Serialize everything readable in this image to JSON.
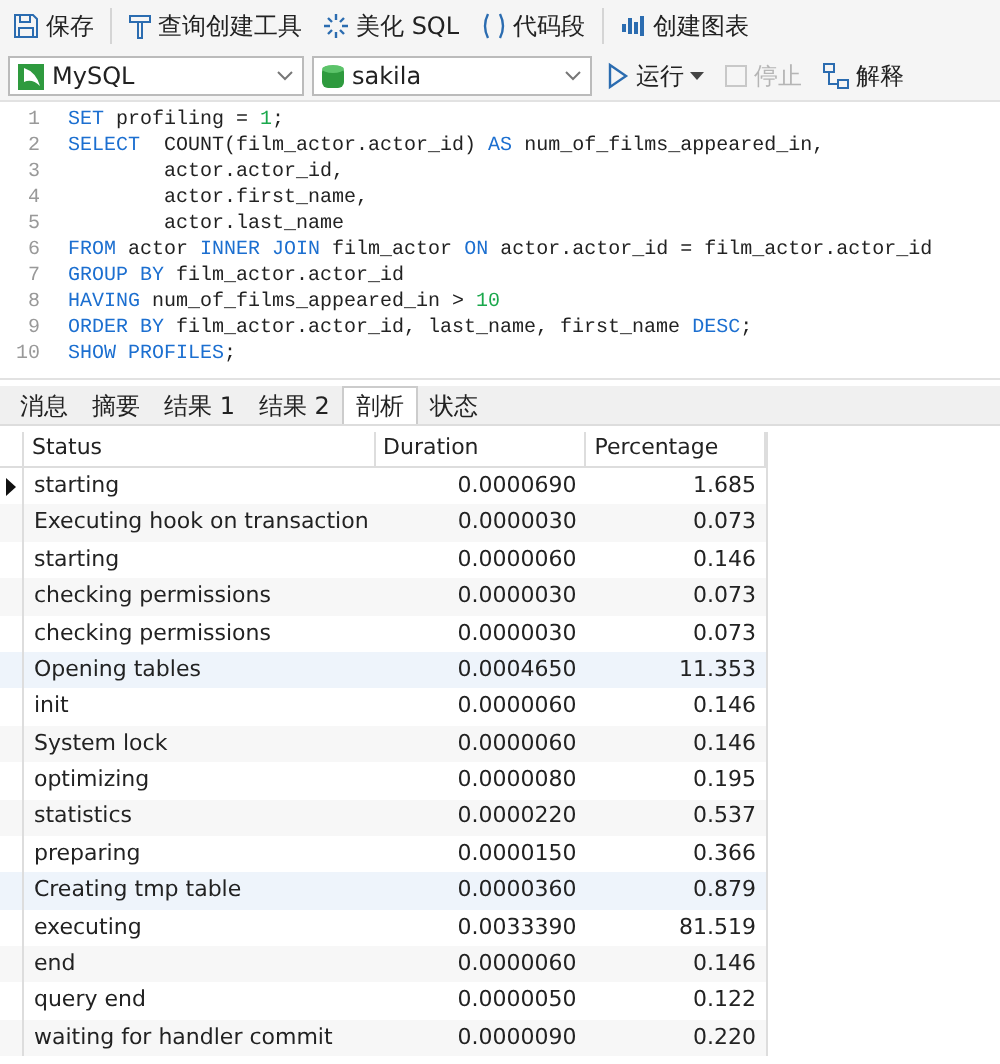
{
  "toolbar": [
    {
      "kind": "save",
      "label": "保存"
    },
    {
      "kind": "builder",
      "label": "查询创建工具"
    },
    {
      "kind": "beautify",
      "label": "美化 SQL"
    },
    {
      "kind": "snippet",
      "label": "代码段"
    },
    {
      "kind": "chart",
      "label": "创建图表"
    }
  ],
  "connection": {
    "value": "MySQL"
  },
  "database": {
    "value": "sakila"
  },
  "actions": [
    {
      "kind": "run",
      "label": "运行",
      "disabled": false
    },
    {
      "kind": "stop",
      "label": "停止",
      "disabled": true
    },
    {
      "kind": "explain",
      "label": "解释",
      "disabled": false
    }
  ],
  "editor": {
    "lines": [
      {
        "number": "1",
        "tokens": [
          {
            "kind": "keyword",
            "text": "SET"
          },
          {
            "kind": "plain",
            "text": " profiling = "
          },
          {
            "kind": "number",
            "text": "1"
          },
          {
            "kind": "plain",
            "text": ";"
          }
        ]
      },
      {
        "number": "2",
        "tokens": [
          {
            "kind": "keyword",
            "text": "SELECT"
          },
          {
            "kind": "plain",
            "text": "  COUNT(film_actor.actor_id) "
          },
          {
            "kind": "keyword",
            "text": "AS"
          },
          {
            "kind": "plain",
            "text": " num_of_films_appeared_in,"
          }
        ]
      },
      {
        "number": "3",
        "tokens": [
          {
            "kind": "plain",
            "text": "        actor.actor_id,"
          }
        ]
      },
      {
        "number": "4",
        "tokens": [
          {
            "kind": "plain",
            "text": "        actor.first_name,"
          }
        ]
      },
      {
        "number": "5",
        "tokens": [
          {
            "kind": "plain",
            "text": "        actor.last_name"
          }
        ]
      },
      {
        "number": "6",
        "tokens": [
          {
            "kind": "keyword",
            "text": "FROM"
          },
          {
            "kind": "plain",
            "text": " actor "
          },
          {
            "kind": "keyword",
            "text": "INNER JOIN"
          },
          {
            "kind": "plain",
            "text": " film_actor "
          },
          {
            "kind": "keyword",
            "text": "ON"
          },
          {
            "kind": "plain",
            "text": " actor.actor_id = film_actor.actor_id"
          }
        ]
      },
      {
        "number": "7",
        "tokens": [
          {
            "kind": "keyword",
            "text": "GROUP BY"
          },
          {
            "kind": "plain",
            "text": " film_actor.actor_id"
          }
        ]
      },
      {
        "number": "8",
        "tokens": [
          {
            "kind": "keyword",
            "text": "HAVING"
          },
          {
            "kind": "plain",
            "text": " num_of_films_appeared_in > "
          },
          {
            "kind": "number",
            "text": "10"
          }
        ]
      },
      {
        "number": "9",
        "tokens": [
          {
            "kind": "keyword",
            "text": "ORDER BY"
          },
          {
            "kind": "plain",
            "text": " film_actor.actor_id, last_name, first_name "
          },
          {
            "kind": "keyword",
            "text": "DESC"
          },
          {
            "kind": "plain",
            "text": ";"
          }
        ]
      },
      {
        "number": "10",
        "tokens": [
          {
            "kind": "keyword",
            "text": "SHOW PROFILES"
          },
          {
            "kind": "plain",
            "text": ";"
          }
        ]
      }
    ]
  },
  "result_tabs": [
    {
      "label": "消息",
      "selected": false
    },
    {
      "label": "摘要",
      "selected": false
    },
    {
      "label": "结果 1",
      "selected": false
    },
    {
      "label": "结果 2",
      "selected": false
    },
    {
      "label": "剖析",
      "selected": true
    },
    {
      "label": "状态",
      "selected": false
    }
  ],
  "table": {
    "columns": [
      "Status",
      "Duration",
      "Percentage"
    ],
    "rows": [
      {
        "current": true,
        "highlighted": false,
        "cells": [
          "starting",
          "0.0000690",
          "1.685"
        ]
      },
      {
        "current": false,
        "highlighted": false,
        "cells": [
          "Executing hook on transaction",
          "0.0000030",
          "0.073"
        ]
      },
      {
        "current": false,
        "highlighted": false,
        "cells": [
          "starting",
          "0.0000060",
          "0.146"
        ]
      },
      {
        "current": false,
        "highlighted": false,
        "cells": [
          "checking permissions",
          "0.0000030",
          "0.073"
        ]
      },
      {
        "current": false,
        "highlighted": false,
        "cells": [
          "checking permissions",
          "0.0000030",
          "0.073"
        ]
      },
      {
        "current": false,
        "highlighted": true,
        "cells": [
          "Opening tables",
          "0.0004650",
          "11.353"
        ]
      },
      {
        "current": false,
        "highlighted": false,
        "cells": [
          "init",
          "0.0000060",
          "0.146"
        ]
      },
      {
        "current": false,
        "highlighted": false,
        "cells": [
          "System lock",
          "0.0000060",
          "0.146"
        ]
      },
      {
        "current": false,
        "highlighted": false,
        "cells": [
          "optimizing",
          "0.0000080",
          "0.195"
        ]
      },
      {
        "current": false,
        "highlighted": false,
        "cells": [
          "statistics",
          "0.0000220",
          "0.537"
        ]
      },
      {
        "current": false,
        "highlighted": false,
        "cells": [
          "preparing",
          "0.0000150",
          "0.366"
        ]
      },
      {
        "current": false,
        "highlighted": true,
        "cells": [
          "Creating tmp table",
          "0.0000360",
          "0.879"
        ]
      },
      {
        "current": false,
        "highlighted": false,
        "cells": [
          "executing",
          "0.0033390",
          "81.519"
        ]
      },
      {
        "current": false,
        "highlighted": false,
        "cells": [
          "end",
          "0.0000060",
          "0.146"
        ]
      },
      {
        "current": false,
        "highlighted": false,
        "cells": [
          "query end",
          "0.0000050",
          "0.122"
        ]
      },
      {
        "current": false,
        "highlighted": false,
        "cells": [
          "waiting for handler commit",
          "0.0000090",
          "0.220"
        ]
      }
    ]
  }
}
